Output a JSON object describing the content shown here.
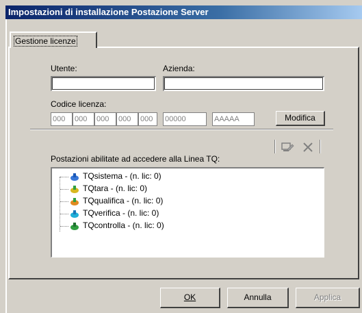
{
  "window": {
    "title": "Impostazioni di installazione Postazione Server"
  },
  "tabs": [
    {
      "label": "Gestione licenze"
    }
  ],
  "form": {
    "utente_label": "Utente:",
    "utente_value": "",
    "azienda_label": "Azienda:",
    "azienda_value": "",
    "codice_label": "Codice licenza:",
    "codice_segments": [
      "000",
      "000",
      "000",
      "000",
      "000"
    ],
    "codice_serial": "00000",
    "codice_key": "AAAAA",
    "modifica_label": "Modifica"
  },
  "stations": {
    "label": "Postazioni abilitate ad accedere alla Linea TQ:",
    "items": [
      {
        "label": "TQsistema - (n. lic: 0)",
        "icon": "tqsistema-icon",
        "color": "#3a78d8"
      },
      {
        "label": "TQtara - (n. lic: 0)",
        "icon": "tqtara-icon",
        "color": "#d8b820"
      },
      {
        "label": "TQqualifica - (n. lic: 0)",
        "icon": "tqqualifica-icon",
        "color": "#e08a20"
      },
      {
        "label": "TQverifica - (n. lic: 0)",
        "icon": "tqverifica-icon",
        "color": "#20b0d8"
      },
      {
        "label": "TQcontrolla - (n. lic: 0)",
        "icon": "tqcontrolla-icon",
        "color": "#30a040"
      }
    ]
  },
  "toolbar": {
    "edit_icon": "edit-station-icon",
    "delete_icon": "delete-icon"
  },
  "buttons": {
    "ok": "OK",
    "annulla": "Annulla",
    "applica": "Applica"
  }
}
